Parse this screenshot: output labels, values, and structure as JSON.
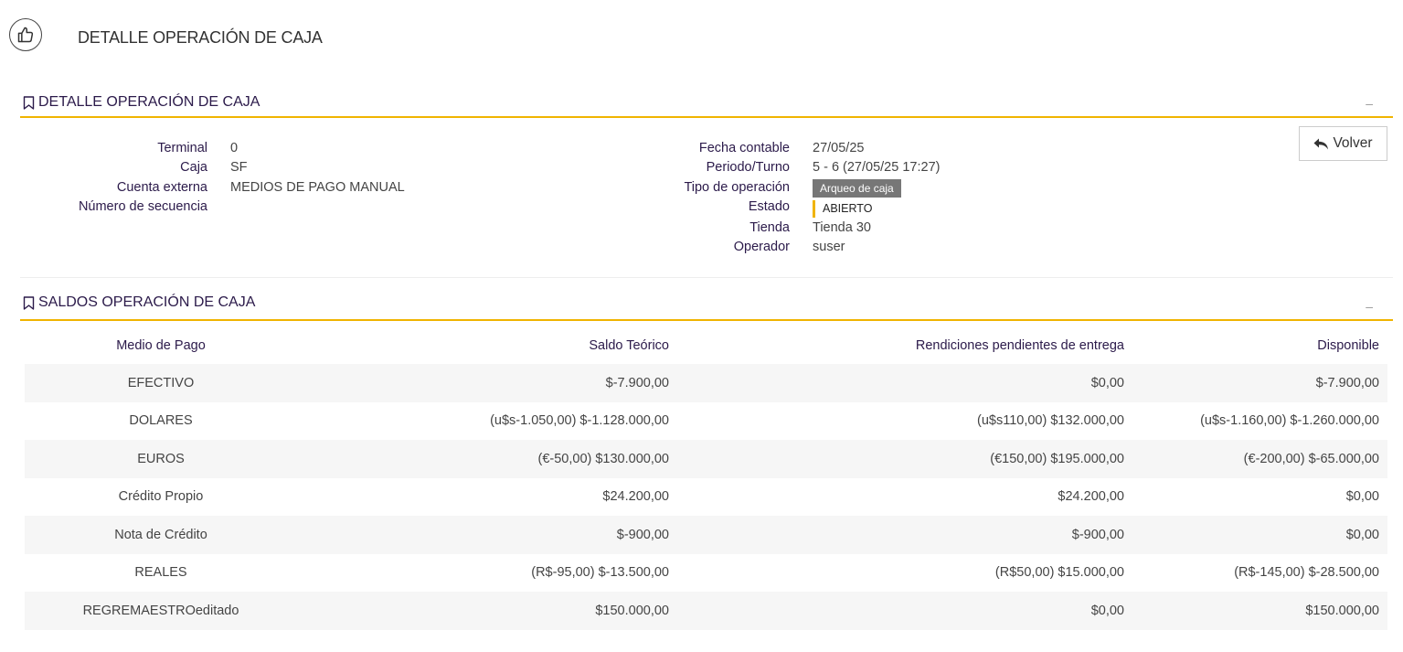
{
  "header": {
    "title": "DETALLE OPERACIÓN DE CAJA",
    "logo_icon": "thumbs-up-icon"
  },
  "detalle": {
    "section_title": "DETALLE OPERACIÓN DE CAJA",
    "collapse_label": "–",
    "back_label": "Volver",
    "left": [
      {
        "label": "Terminal",
        "value": "0"
      },
      {
        "label": "Caja",
        "value": "SF"
      },
      {
        "label": "Cuenta externa",
        "value": "MEDIOS DE PAGO MANUAL"
      },
      {
        "label": "Número de secuencia",
        "value": ""
      }
    ],
    "right": {
      "fecha_label": "Fecha contable",
      "fecha_value": "27/05/25",
      "periodo_label": "Periodo/Turno",
      "periodo_value": "5 - 6 (27/05/25 17:27)",
      "tipo_label": "Tipo de operación",
      "tipo_value": "Arqueo de caja",
      "estado_label": "Estado",
      "estado_value": "ABIERTO",
      "tienda_label": "Tienda",
      "tienda_value": "Tienda 30",
      "operador_label": "Operador",
      "operador_value": "suser"
    }
  },
  "saldos": {
    "section_title": "SALDOS OPERACIÓN DE CAJA",
    "collapse_label": "–",
    "columns": [
      "Medio de Pago",
      "Saldo Teórico",
      "Rendiciones pendientes de entrega",
      "Disponible"
    ],
    "rows": [
      [
        "EFECTIVO",
        "$-7.900,00",
        "$0,00",
        "$-7.900,00"
      ],
      [
        "DOLARES",
        "(u$s-1.050,00) $-1.128.000,00",
        "(u$s110,00) $132.000,00",
        "(u$s-1.160,00) $-1.260.000,00"
      ],
      [
        "EUROS",
        "(€-50,00) $130.000,00",
        "(€150,00) $195.000,00",
        "(€-200,00) $-65.000,00"
      ],
      [
        "Crédito Propio",
        "$24.200,00",
        "$24.200,00",
        "$0,00"
      ],
      [
        "Nota de Crédito",
        "$-900,00",
        "$-900,00",
        "$0,00"
      ],
      [
        "REALES",
        "(R$-95,00) $-13.500,00",
        "(R$50,00) $15.000,00",
        "(R$-145,00) $-28.500,00"
      ],
      [
        "REGREMAESTROeditado",
        "$150.000,00",
        "$0,00",
        "$150.000,00"
      ]
    ]
  },
  "colors": {
    "accent": "#f0b400",
    "label": "#2b1a4a",
    "badge_gray": "#777777"
  }
}
